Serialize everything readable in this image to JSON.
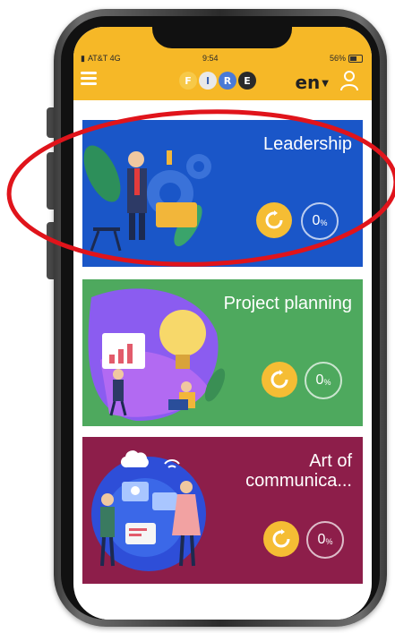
{
  "status_bar": {
    "carrier": "AT&T 4G",
    "time": "9:54",
    "battery": "56%"
  },
  "header": {
    "logo_letters": [
      "F",
      "I",
      "R",
      "E"
    ],
    "language": "en",
    "menu_icon": "hamburger-menu-icon",
    "user_icon": "user-profile-icon"
  },
  "courses": [
    {
      "title": "Leadership",
      "progress_value": "0",
      "progress_unit": "%",
      "progress": 0,
      "color": "#1a56c8"
    },
    {
      "title": "Project planning",
      "progress_value": "0",
      "progress_unit": "%",
      "progress": 0,
      "color": "#4ea95e"
    },
    {
      "title": "Art of communica...",
      "progress_value": "0",
      "progress_unit": "%",
      "progress": 0,
      "color": "#8d1e4a"
    }
  ],
  "colors": {
    "header": "#f6b827",
    "accent": "#f5bd34",
    "annotation": "#e0141b"
  }
}
